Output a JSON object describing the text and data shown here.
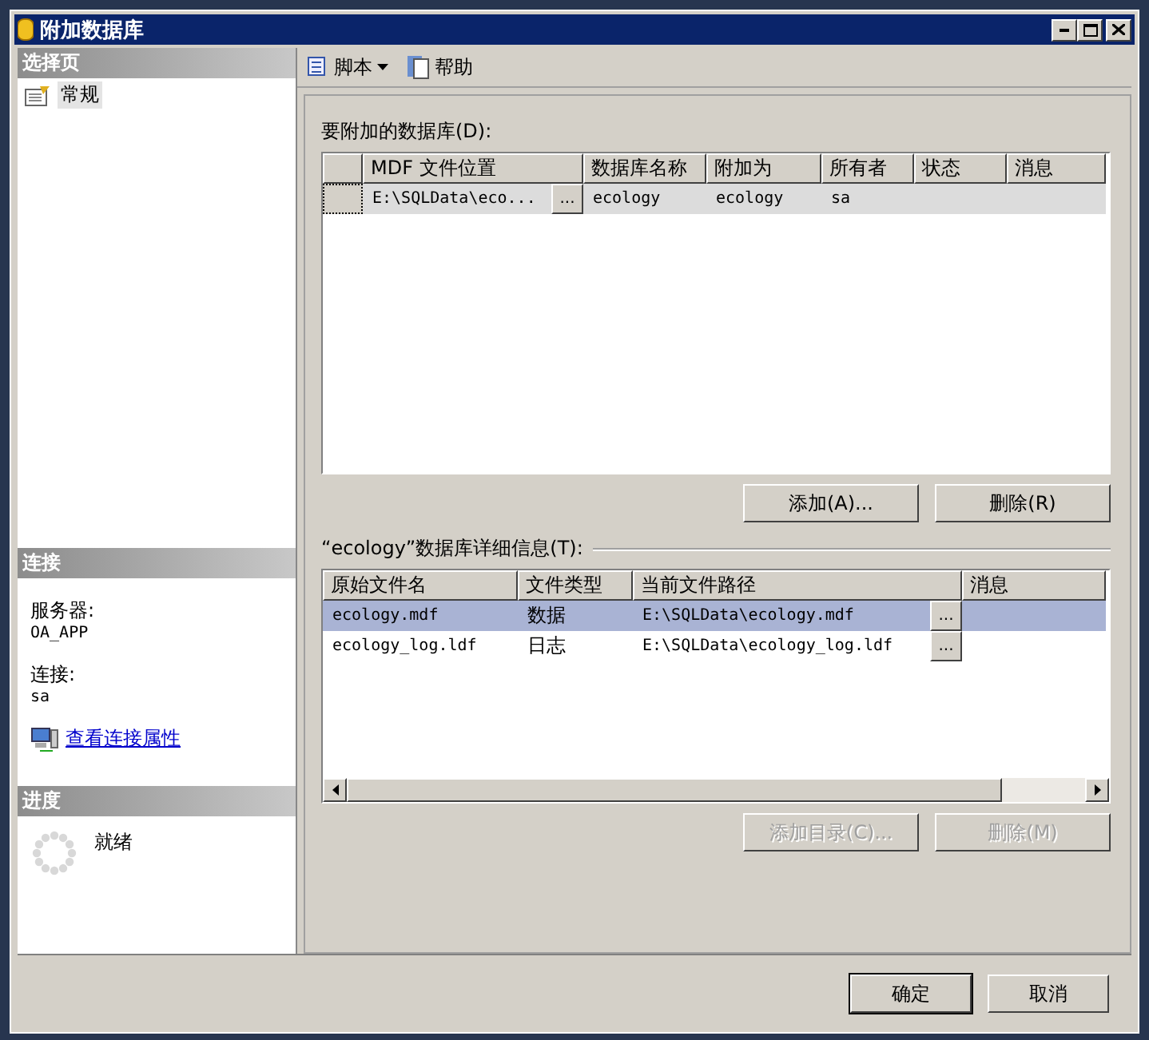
{
  "window": {
    "title": "附加数据库"
  },
  "sidebar": {
    "pages_header": "选择页",
    "pages": [
      {
        "label": "常规",
        "selected": true
      }
    ],
    "connection_header": "连接",
    "connection_fields": [
      {
        "label": "服务器:",
        "value": "OA_APP"
      },
      {
        "label": "连接:",
        "value": "sa"
      }
    ],
    "connection_link": "查看连接属性",
    "progress_header": "进度",
    "progress_status": "就绪"
  },
  "toolbar": [
    {
      "label": "脚本",
      "kind": "dropdown"
    },
    {
      "label": "帮助",
      "kind": "help"
    }
  ],
  "databases": {
    "label": "要附加的数据库(D):",
    "columns": [
      "MDF 文件位置",
      "数据库名称",
      "附加为",
      "所有者",
      "状态",
      "消息"
    ],
    "rows": [
      {
        "selected": true,
        "cells": [
          {
            "text": "E:\\SQLData\\eco...",
            "browse": "..."
          },
          {
            "text": "ecology"
          },
          {
            "text": "ecology"
          },
          {
            "text": "sa"
          },
          {
            "text": ""
          },
          {
            "text": ""
          }
        ]
      }
    ],
    "buttons": [
      {
        "label": "添加(A)...",
        "disabled": false
      },
      {
        "label": "删除(R)",
        "disabled": false
      }
    ]
  },
  "details": {
    "label": "“ecology”数据库详细信息(T):",
    "columns": [
      "原始文件名",
      "文件类型",
      "当前文件路径",
      "消息"
    ],
    "rows": [
      {
        "selected": true,
        "cells": [
          {
            "text": "ecology.mdf"
          },
          {
            "text": "数据"
          },
          {
            "text": "E:\\SQLData\\ecology.mdf",
            "browse": "..."
          },
          {
            "text": ""
          }
        ]
      },
      {
        "selected": false,
        "cells": [
          {
            "text": "ecology_log.ldf"
          },
          {
            "text": "日志"
          },
          {
            "text": "E:\\SQLData\\ecology_log.ldf",
            "browse": "..."
          },
          {
            "text": ""
          }
        ]
      }
    ],
    "buttons": [
      {
        "label": "添加目录(C)...",
        "disabled": true
      },
      {
        "label": "删除(M)",
        "disabled": true
      }
    ]
  },
  "footer_buttons": [
    {
      "label": "确定",
      "default": true
    },
    {
      "label": "取消",
      "default": false
    }
  ]
}
